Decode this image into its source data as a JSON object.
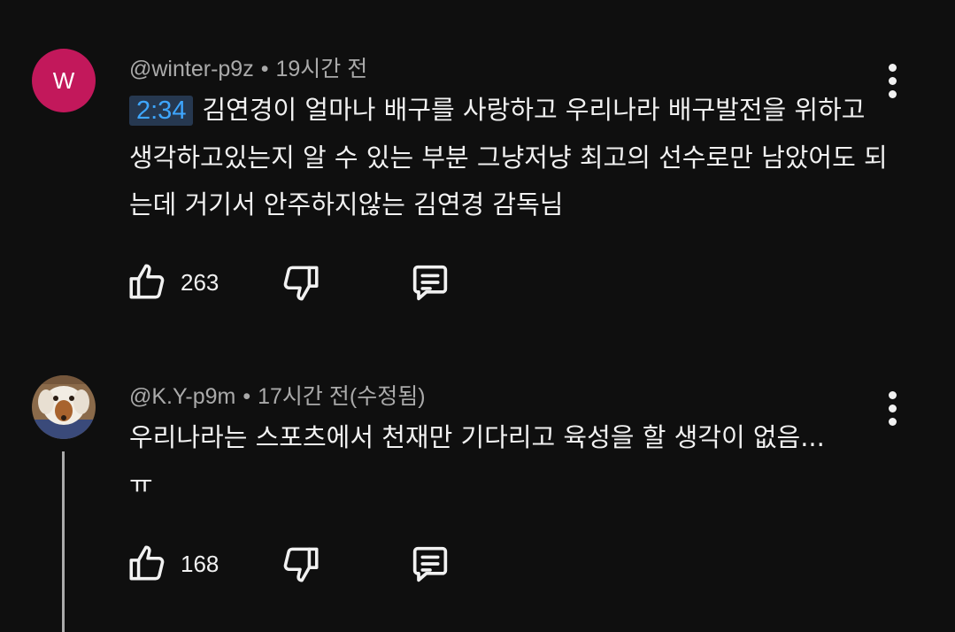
{
  "comments": [
    {
      "avatar_letter": "W",
      "avatar_color": "#c2185b",
      "author": "@winter-p9z",
      "time": "19시간 전",
      "timestamp_link": "2:34",
      "text": "김연경이 얼마나 배구를 사랑하고 우리나라 배구발전을 위하고 생각하고있는지 알 수 있는 부분 그냥저냥 최고의 선수로만 남았어도 되는데 거기서 안주하지않는 김연경 감독님",
      "likes": "263",
      "like_icon": "thumbs-up-icon",
      "dislike_icon": "thumbs-down-icon",
      "reply_icon": "reply-icon",
      "more_icon": "more-vertical-icon"
    },
    {
      "avatar_desc": "puppy-photo",
      "author": "@K.Y-p9m",
      "time": "17시간 전(수정됨)",
      "text": "우리나라는 스포츠에서 천재만 기다리고 육성을 할 생각이 없음...ㅠ",
      "likes": "168",
      "like_icon": "thumbs-up-icon",
      "dislike_icon": "thumbs-down-icon",
      "reply_icon": "reply-icon",
      "more_icon": "more-vertical-icon"
    }
  ],
  "colors": {
    "background": "#0f0f0f",
    "text_primary": "#f1f1f1",
    "text_secondary": "#aaaaaa",
    "timestamp_link": "#3ea6ff",
    "timestamp_bg": "#263850"
  }
}
